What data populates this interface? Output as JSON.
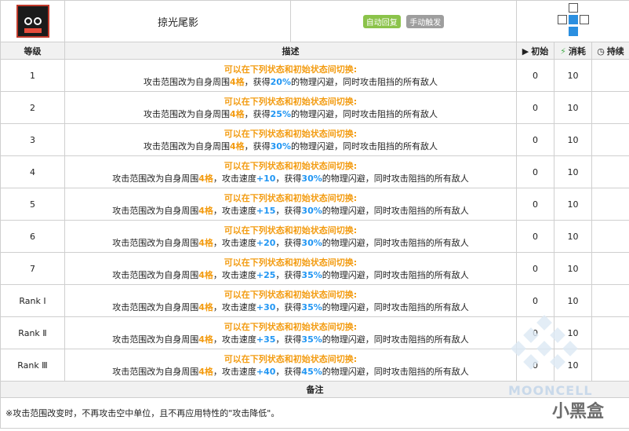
{
  "skill": {
    "icon": "skill-fin-eyes-icon",
    "name": "掠光尾影",
    "tags": [
      "自动回复",
      "手动触发"
    ],
    "range_icon": "attack-range-grid-icon"
  },
  "columns": {
    "level": "等级",
    "desc": "描述",
    "initial": "初始",
    "cost": "消耗",
    "duration": "持续"
  },
  "rows": [
    {
      "level": "1",
      "line1": "可以在下列状态和初始状态间切换:",
      "a": "攻击范围改为自身周围",
      "range": "4格",
      "b": "，获得",
      "evade": "20%",
      "c": "的物理闪避，同时攻击阻挡的所有敌人",
      "speed": "",
      "init": "0",
      "cost": "10",
      "dur": ""
    },
    {
      "level": "2",
      "line1": "可以在下列状态和初始状态间切换:",
      "a": "攻击范围改为自身周围",
      "range": "4格",
      "b": "，获得",
      "evade": "25%",
      "c": "的物理闪避，同时攻击阻挡的所有敌人",
      "speed": "",
      "init": "0",
      "cost": "10",
      "dur": ""
    },
    {
      "level": "3",
      "line1": "可以在下列状态和初始状态间切换:",
      "a": "攻击范围改为自身周围",
      "range": "4格",
      "b": "，获得",
      "evade": "30%",
      "c": "的物理闪避，同时攻击阻挡的所有敌人",
      "speed": "",
      "init": "0",
      "cost": "10",
      "dur": ""
    },
    {
      "level": "4",
      "line1": "可以在下列状态和初始状态间切换:",
      "a": "攻击范围改为自身周围",
      "range": "4格",
      "b": "，攻击速度",
      "speed": "+10",
      "b2": "，获得",
      "evade": "30%",
      "c": "的物理闪避，同时攻击阻挡的所有敌人",
      "init": "0",
      "cost": "10",
      "dur": ""
    },
    {
      "level": "5",
      "line1": "可以在下列状态和初始状态间切换:",
      "a": "攻击范围改为自身周围",
      "range": "4格",
      "b": "，攻击速度",
      "speed": "+15",
      "b2": "，获得",
      "evade": "30%",
      "c": "的物理闪避，同时攻击阻挡的所有敌人",
      "init": "0",
      "cost": "10",
      "dur": ""
    },
    {
      "level": "6",
      "line1": "可以在下列状态和初始状态间切换:",
      "a": "攻击范围改为自身周围",
      "range": "4格",
      "b": "，攻击速度",
      "speed": "+20",
      "b2": "，获得",
      "evade": "30%",
      "c": "的物理闪避，同时攻击阻挡的所有敌人",
      "init": "0",
      "cost": "10",
      "dur": ""
    },
    {
      "level": "7",
      "line1": "可以在下列状态和初始状态间切换:",
      "a": "攻击范围改为自身周围",
      "range": "4格",
      "b": "，攻击速度",
      "speed": "+25",
      "b2": "，获得",
      "evade": "35%",
      "c": "的物理闪避，同时攻击阻挡的所有敌人",
      "init": "0",
      "cost": "10",
      "dur": ""
    },
    {
      "level": "Rank Ⅰ",
      "line1": "可以在下列状态和初始状态间切换:",
      "a": "攻击范围改为自身周围",
      "range": "4格",
      "b": "，攻击速度",
      "speed": "+30",
      "b2": "，获得",
      "evade": "35%",
      "c": "的物理闪避，同时攻击阻挡的所有敌人",
      "init": "0",
      "cost": "10",
      "dur": ""
    },
    {
      "level": "Rank Ⅱ",
      "line1": "可以在下列状态和初始状态间切换:",
      "a": "攻击范围改为自身周围",
      "range": "4格",
      "b": "，攻击速度",
      "speed": "+35",
      "b2": "，获得",
      "evade": "35%",
      "c": "的物理闪避，同时攻击阻挡的所有敌人",
      "init": "0",
      "cost": "10",
      "dur": ""
    },
    {
      "level": "Rank Ⅲ",
      "line1": "可以在下列状态和初始状态间切换:",
      "a": "攻击范围改为自身周围",
      "range": "4格",
      "b": "，攻击速度",
      "speed": "+40",
      "b2": "，获得",
      "evade": "45%",
      "c": "的物理闪避，同时攻击阻挡的所有敌人",
      "init": "0",
      "cost": "10",
      "dur": ""
    }
  ],
  "notes": {
    "header": "备注",
    "text": "※攻击范围改变时，不再攻击空中单位，且不再应用特性的\"攻击降低\"。"
  },
  "watermark": {
    "brand": "MOONCELL",
    "site": "小黑盒"
  },
  "colors": {
    "orange": "#f39c12",
    "blue": "#2196f3",
    "auto_tag": "#8bc34a",
    "manual_tag": "#9e9e9e"
  }
}
